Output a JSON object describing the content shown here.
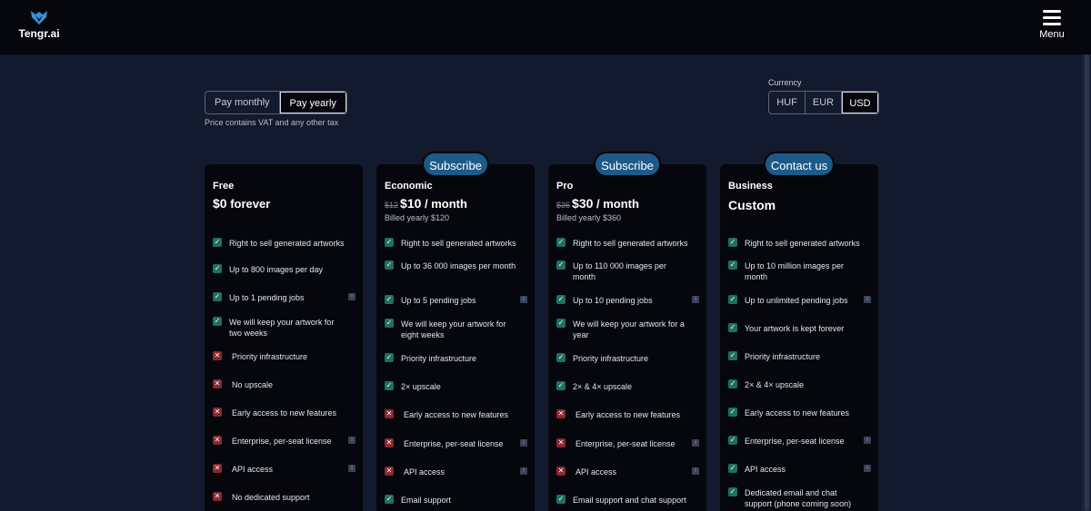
{
  "header": {
    "logo_text": "Tengr.ai",
    "menu_label": "Menu"
  },
  "billing": {
    "options": [
      "Pay monthly",
      "Pay yearly"
    ],
    "selected": "Pay yearly",
    "note": "Price contains VAT and any other tax"
  },
  "currency": {
    "label": "Currency",
    "options": [
      "HUF",
      "EUR",
      "USD"
    ],
    "selected": "USD"
  },
  "colors": {
    "accent": "#1d5a87",
    "check": "#1f6f62",
    "cross": "#8b2730",
    "background": "#131a2e",
    "card": "#05070c"
  },
  "plans": [
    {
      "name": "Free",
      "badge": "",
      "old_price": "",
      "price": "$0",
      "price_suffix": " forever",
      "billed": "",
      "features": [
        {
          "text": "Right to sell generated artworks",
          "included": true,
          "info": false
        },
        {
          "text": "Up to 800 images per day",
          "included": true,
          "info": false
        },
        {
          "text": "Up to 1 pending jobs",
          "included": true,
          "info": true
        },
        {
          "text": "We will keep your artwork for two weeks",
          "included": true,
          "info": false
        },
        {
          "text": "Priority infrastructure",
          "included": false,
          "info": false
        },
        {
          "text": "No upscale",
          "included": false,
          "info": false
        },
        {
          "text": "Early access to new features",
          "included": false,
          "info": false
        },
        {
          "text": "Enterprise, per-seat license",
          "included": false,
          "info": true
        },
        {
          "text": "API access",
          "included": false,
          "info": true
        },
        {
          "text": "No dedicated support",
          "included": false,
          "info": false
        }
      ]
    },
    {
      "name": "Economic",
      "badge": "Subscribe",
      "old_price": "$12",
      "price": "$10",
      "price_suffix": " / month",
      "billed": "Billed yearly $120",
      "features": [
        {
          "text": "Right to sell generated artworks",
          "included": true,
          "info": false
        },
        {
          "text": "Up to 36 000 images per month",
          "included": true,
          "info": false
        },
        {
          "text": "Up to 5 pending jobs",
          "included": true,
          "info": true
        },
        {
          "text": "We will keep your artwork for eight weeks",
          "included": true,
          "info": false
        },
        {
          "text": "Priority infrastructure",
          "included": true,
          "info": false
        },
        {
          "text": "2× upscale",
          "included": true,
          "info": false
        },
        {
          "text": "Early access to new features",
          "included": false,
          "info": false
        },
        {
          "text": "Enterprise, per-seat license",
          "included": false,
          "info": true
        },
        {
          "text": "API access",
          "included": false,
          "info": true
        },
        {
          "text": "Email support",
          "included": true,
          "info": false
        }
      ]
    },
    {
      "name": "Pro",
      "badge": "Subscribe",
      "old_price": "$36",
      "price": "$30",
      "price_suffix": " / month",
      "billed": "Billed yearly $360",
      "features": [
        {
          "text": "Right to sell generated artworks",
          "included": true,
          "info": false
        },
        {
          "text": "Up to 110 000 images per month",
          "included": true,
          "info": false
        },
        {
          "text": "Up to 10 pending jobs",
          "included": true,
          "info": true
        },
        {
          "text": "We will keep your artwork for a year",
          "included": true,
          "info": false
        },
        {
          "text": "Priority infrastructure",
          "included": true,
          "info": false
        },
        {
          "text": "2× & 4× upscale",
          "included": true,
          "info": false
        },
        {
          "text": "Early access to new features",
          "included": false,
          "info": false
        },
        {
          "text": "Enterprise, per-seat license",
          "included": false,
          "info": true
        },
        {
          "text": "API access",
          "included": false,
          "info": true
        },
        {
          "text": "Email support and chat support",
          "included": true,
          "info": false
        }
      ]
    },
    {
      "name": "Business",
      "badge": "Contact us",
      "old_price": "",
      "price": "Custom",
      "price_suffix": "",
      "billed": "",
      "features": [
        {
          "text": "Right to sell generated artworks",
          "included": true,
          "info": false
        },
        {
          "text": "Up to 10 million images per month",
          "included": true,
          "info": false
        },
        {
          "text": "Up to unlimited pending jobs",
          "included": true,
          "info": true
        },
        {
          "text": "Your artwork is kept forever",
          "included": true,
          "info": false
        },
        {
          "text": "Priority infrastructure",
          "included": true,
          "info": false
        },
        {
          "text": "2× & 4× upscale",
          "included": true,
          "info": false
        },
        {
          "text": "Early access to new features",
          "included": true,
          "info": false
        },
        {
          "text": "Enterprise, per-seat license",
          "included": true,
          "info": true
        },
        {
          "text": "API access",
          "included": true,
          "info": true
        },
        {
          "text": "Dedicated email and chat support (phone coming soon)",
          "included": true,
          "info": false
        }
      ]
    }
  ]
}
